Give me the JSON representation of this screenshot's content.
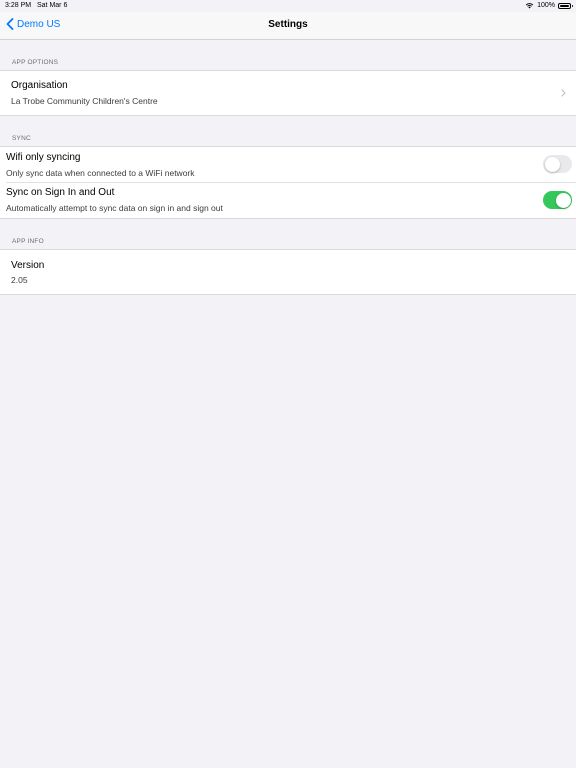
{
  "status_bar": {
    "time": "3:28 PM",
    "date": "Sat Mar 6",
    "battery": "100%",
    "icons": [
      "wifi-icon",
      "battery-icon"
    ]
  },
  "nav": {
    "back_label": "Demo US",
    "title": "Settings",
    "accent_color": "#007aff"
  },
  "sections": {
    "app_options": {
      "header": "APP OPTIONS",
      "organisation": {
        "title": "Organisation",
        "value": "La Trobe Community Children's Centre"
      }
    },
    "sync": {
      "header": "SYNC",
      "wifi_only": {
        "title": "Wifi only syncing",
        "subtitle": "Only sync data when connected to a WiFi network",
        "enabled": false
      },
      "sync_sign_in_out": {
        "title": "Sync on Sign In and Out",
        "subtitle": "Automatically attempt to sync data on sign in and sign out",
        "enabled": true
      }
    },
    "app_info": {
      "header": "APP INFO",
      "version": {
        "title": "Version",
        "value": "2.05"
      }
    }
  },
  "colors": {
    "toggle_on": "#34c759",
    "toggle_off": "#e9e9eb",
    "background": "#f2f2f7"
  }
}
